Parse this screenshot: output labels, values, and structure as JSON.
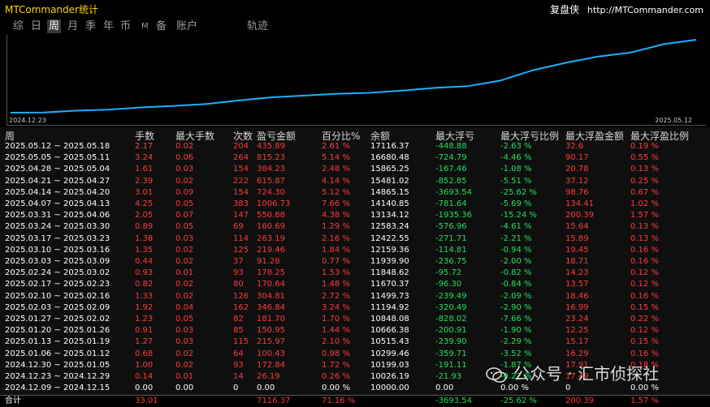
{
  "app": {
    "title": "MTCommander统计",
    "brand_name": "复盘侠",
    "brand_url": "http://MTCommander.com"
  },
  "tabs": [
    {
      "label": "综",
      "active": false
    },
    {
      "label": "日",
      "active": false
    },
    {
      "label": "周",
      "active": true
    },
    {
      "label": "月",
      "active": false
    },
    {
      "label": "季",
      "active": false
    },
    {
      "label": "年",
      "active": false
    },
    {
      "label": "币",
      "active": false
    },
    {
      "label": "M",
      "active": false
    },
    {
      "label": "备",
      "active": false
    },
    {
      "label": "账户",
      "active": false
    },
    {
      "label": "轨迹",
      "active": false
    }
  ],
  "chart_data": {
    "type": "line",
    "x_start_label": "2024.12.23",
    "x_end_label": "2025.05.12",
    "line_color": "#1ab0ff",
    "series": [
      {
        "values": [
          10000.0,
          10026.13,
          10199.03,
          10299.46,
          10515.43,
          10666.38,
          10848.08,
          11194.92,
          11499.73,
          11670.37,
          11848.62,
          11939.9,
          12159.36,
          12422.55,
          12583.24,
          13134.12,
          14140.85,
          14865.15,
          15481.02,
          15865.25,
          16680.48,
          17116.37
        ]
      }
    ]
  },
  "table": {
    "headers": [
      "周",
      "手数",
      "最大手数",
      "次数",
      "盈亏金额",
      "百分比%",
      "余额",
      "最大浮亏",
      "最大浮亏比例",
      "最大浮盈金额",
      "最大浮盈比例"
    ],
    "rows": [
      [
        "2025.05.12 ~ 2025.05.18",
        "2.17",
        "0.02",
        "204",
        "435.89",
        "2.61 %",
        "17116.37",
        "-448.88",
        "-2.63 %",
        "32.6",
        "0.19 %"
      ],
      [
        "2025.05.05 ~ 2025.05.11",
        "3.24",
        "0.06",
        "264",
        "815.23",
        "5.14 %",
        "16680.48",
        "-724.79",
        "-4.46 %",
        "90.17",
        "0.55 %"
      ],
      [
        "2025.04.28 ~ 2025.05.04",
        "1.61",
        "0.03",
        "154",
        "384.23",
        "2.48 %",
        "15865.25",
        "-167.46",
        "-1.08 %",
        "20.78",
        "0.13 %"
      ],
      [
        "2025.04.21 ~ 2025.04.27",
        "2.39",
        "0.02",
        "222",
        "615.87",
        "4.14 %",
        "15481.02",
        "-852.85",
        "-5.51 %",
        "37.12",
        "0.25 %"
      ],
      [
        "2025.04.14 ~ 2025.04.20",
        "3.01",
        "0.09",
        "154",
        "724.30",
        "5.12 %",
        "14865.15",
        "-3693.54",
        "-25.62 %",
        "98.76",
        "0.67 %"
      ],
      [
        "2025.04.07 ~ 2025.04.13",
        "4.25",
        "0.05",
        "383",
        "1006.73",
        "7.66 %",
        "14140.85",
        "-781.64",
        "-5.69 %",
        "134.41",
        "1.02 %"
      ],
      [
        "2025.03.31 ~ 2025.04.06",
        "2.05",
        "0.07",
        "147",
        "550.88",
        "4.38 %",
        "13134.12",
        "-1935.36",
        "-15.24 %",
        "200.39",
        "1.57 %"
      ],
      [
        "2025.03.24 ~ 2025.03.30",
        "0.89",
        "0.05",
        "69",
        "160.69",
        "1.29 %",
        "12583.24",
        "-576.96",
        "-4.61 %",
        "15.64",
        "0.13 %"
      ],
      [
        "2025.03.17 ~ 2025.03.23",
        "1.38",
        "0.03",
        "114",
        "263.19",
        "2.16 %",
        "12422.55",
        "-271.71",
        "-2.21 %",
        "15.89",
        "0.13 %"
      ],
      [
        "2025.03.10 ~ 2025.03.16",
        "1.35",
        "0.02",
        "125",
        "219.46",
        "1.84 %",
        "12159.36",
        "-114.81",
        "-0.94 %",
        "19.45",
        "0.16 %"
      ],
      [
        "2025.03.03 ~ 2025.03.09",
        "0.44",
        "0.02",
        "37",
        "91.28",
        "0.77 %",
        "11939.90",
        "-236.75",
        "-2.00 %",
        "18.71",
        "0.16 %"
      ],
      [
        "2025.02.24 ~ 2025.03.02",
        "0.93",
        "0.01",
        "93",
        "178.25",
        "1.53 %",
        "11848.62",
        "-95.72",
        "-0.82 %",
        "14.23",
        "0.12 %"
      ],
      [
        "2025.02.17 ~ 2025.02.23",
        "0.82",
        "0.02",
        "80",
        "170.64",
        "1.48 %",
        "11670.37",
        "-96.30",
        "-0.84 %",
        "13.57",
        "0.12 %"
      ],
      [
        "2025.02.10 ~ 2025.02.16",
        "1.33",
        "0.02",
        "126",
        "304.81",
        "2.72 %",
        "11499.73",
        "-239.49",
        "-2.09 %",
        "18.46",
        "0.16 %"
      ],
      [
        "2025.02.03 ~ 2025.02.09",
        "1.92",
        "0.04",
        "162",
        "346.84",
        "3.24 %",
        "11194.92",
        "-320.49",
        "-2.90 %",
        "16.99",
        "0.15 %"
      ],
      [
        "2025.01.27 ~ 2025.02.02",
        "1.23",
        "0.05",
        "82",
        "181.70",
        "1.70 %",
        "10848.08",
        "-828.02",
        "-7.66 %",
        "23.24",
        "0.22 %"
      ],
      [
        "2025.01.20 ~ 2025.01.26",
        "0.91",
        "0.03",
        "85",
        "150.95",
        "1.44 %",
        "10666.38",
        "-200.91",
        "-1.90 %",
        "12.25",
        "0.12 %"
      ],
      [
        "2025.01.13 ~ 2025.01.19",
        "1.27",
        "0.03",
        "115",
        "215.97",
        "2.10 %",
        "10515.43",
        "-239.90",
        "-2.29 %",
        "15.17",
        "0.15 %"
      ],
      [
        "2025.01.06 ~ 2025.01.12",
        "0.68",
        "0.02",
        "64",
        "100.43",
        "0.98 %",
        "10299.46",
        "-359.71",
        "-3.52 %",
        "16.29",
        "0.16 %"
      ],
      [
        "2024.12.30 ~ 2025.01.05",
        "1.00",
        "0.02",
        "93",
        "172.84",
        "1.72 %",
        "10199.03",
        "-191.11",
        "-1.87 %",
        "17.91",
        "0.18 %"
      ],
      [
        "2024.12.23 ~ 2024.12.29",
        "0.14",
        "0.01",
        "14",
        "26.19",
        "0.26 %",
        "10026.19",
        "-21.93",
        "-0.22 %",
        "17.49",
        ""
      ],
      [
        "2024.12.09 ~ 2024.12.15",
        "0.00",
        "0.00",
        "0",
        "0.00",
        "0.00 %",
        "10000.00",
        "0.00",
        "0.00 %",
        "0",
        "0.00 %"
      ]
    ],
    "total": [
      "合计",
      "33.01",
      "",
      "",
      "7116.37",
      "71.16 %",
      "",
      "-3693.54",
      "-25.62 %",
      "200.39",
      "1.57 %"
    ]
  },
  "colors": {
    "positive": "#ff3b3b",
    "negative": "#22e05a",
    "neutral": "#ffffff",
    "line": "#1ab0ff"
  },
  "watermark": {
    "text": "公众号 · 汇市侦探社"
  }
}
